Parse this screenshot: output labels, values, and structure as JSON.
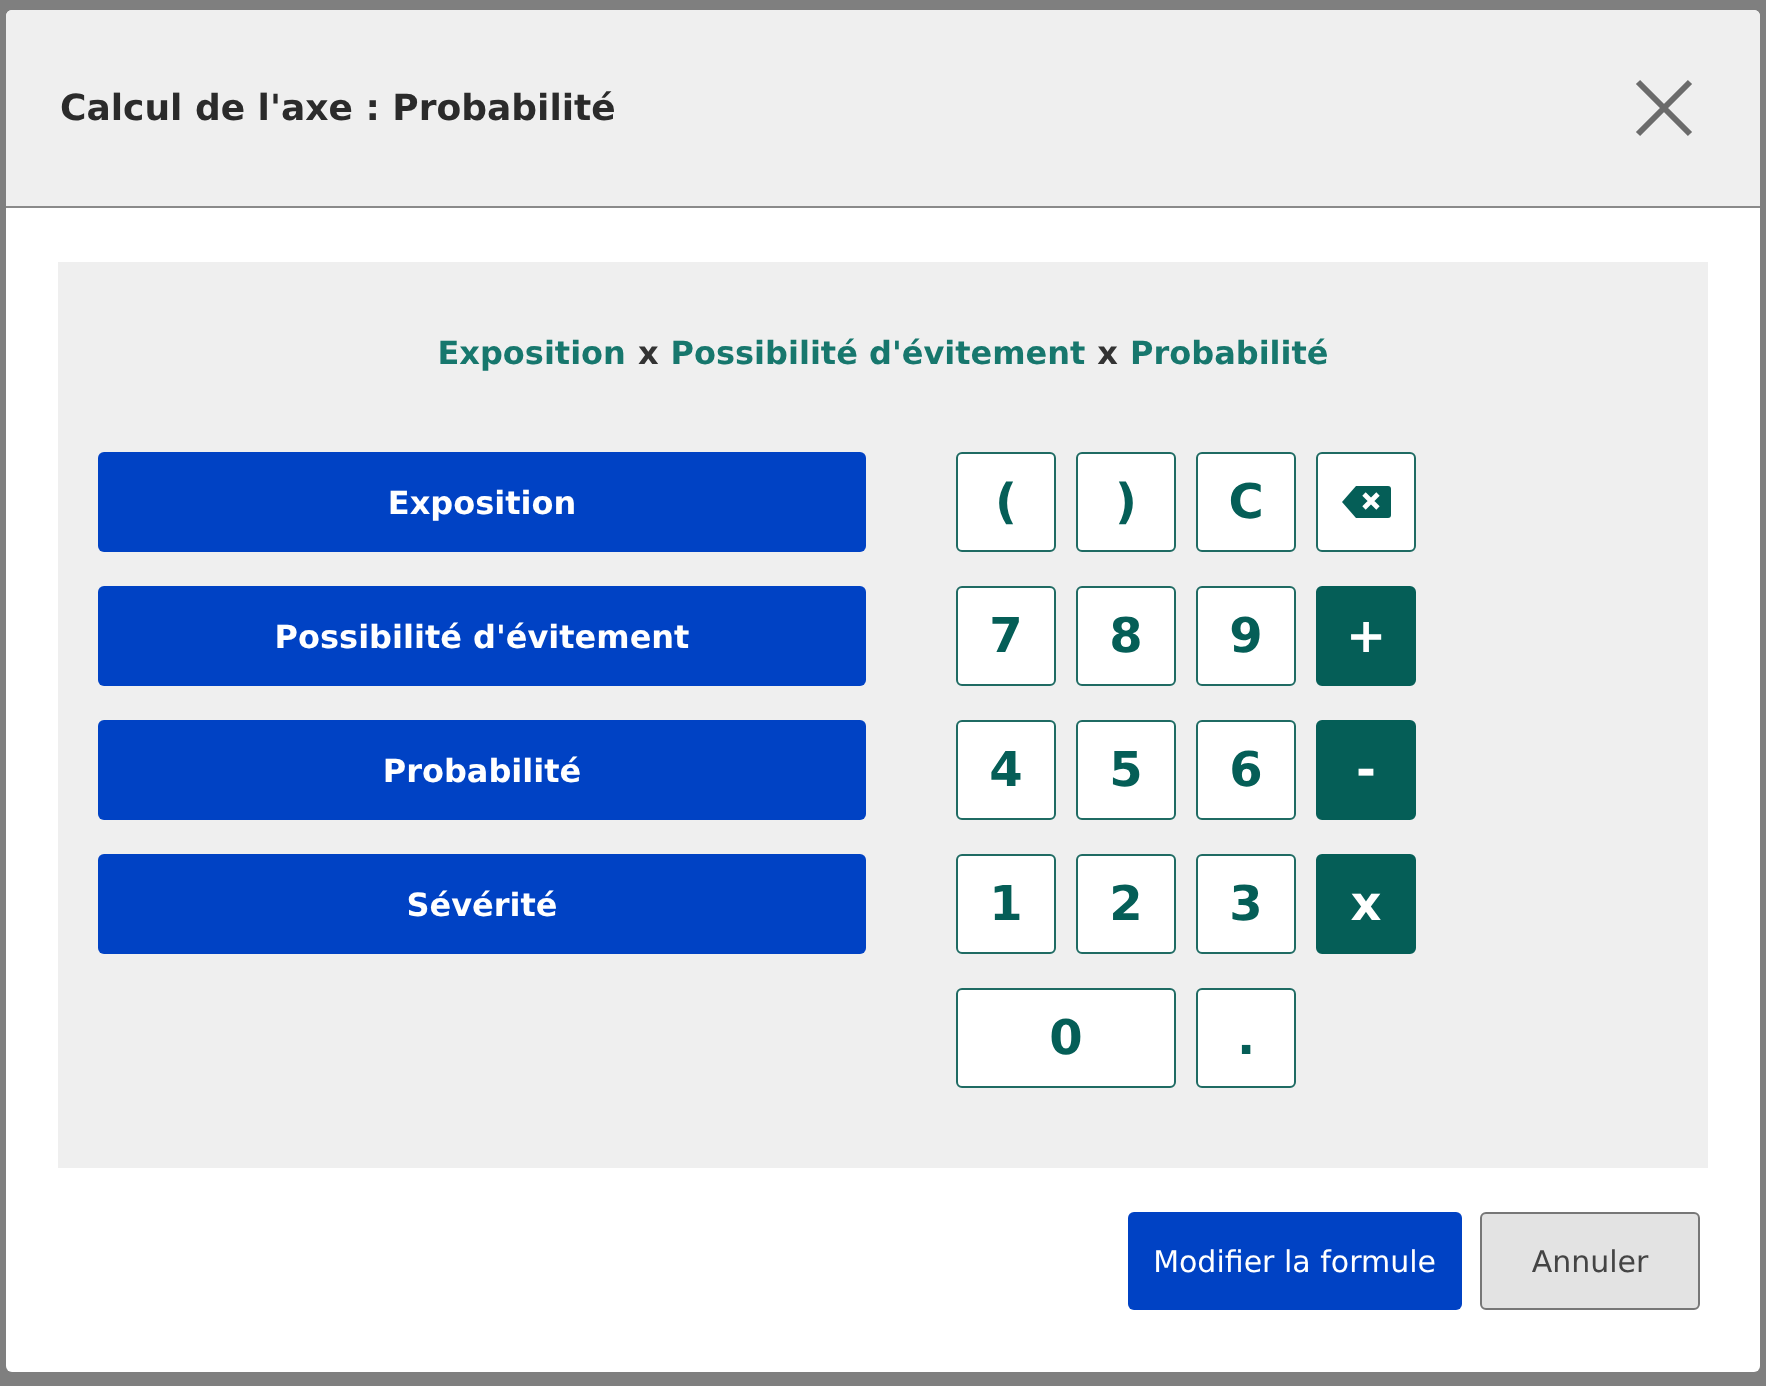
{
  "dialog": {
    "title": "Calcul de l'axe : Probabilité"
  },
  "formula": [
    {
      "kind": "variable",
      "text": "Exposition"
    },
    {
      "kind": "operator",
      "text": "x"
    },
    {
      "kind": "variable",
      "text": "Possibilité d'évitement"
    },
    {
      "kind": "operator",
      "text": "x"
    },
    {
      "kind": "variable",
      "text": "Probabilité"
    }
  ],
  "variables": [
    "Exposition",
    "Possibilité d'évitement",
    "Probabilité",
    "Sévérité"
  ],
  "keypad": [
    {
      "kind": "key",
      "label": "("
    },
    {
      "kind": "key",
      "label": ")"
    },
    {
      "kind": "key",
      "label": "C"
    },
    {
      "kind": "backspace"
    },
    {
      "kind": "key",
      "label": "7"
    },
    {
      "kind": "key",
      "label": "8"
    },
    {
      "kind": "key",
      "label": "9"
    },
    {
      "kind": "operator",
      "label": "+"
    },
    {
      "kind": "key",
      "label": "4"
    },
    {
      "kind": "key",
      "label": "5"
    },
    {
      "kind": "key",
      "label": "6"
    },
    {
      "kind": "operator",
      "label": "-"
    },
    {
      "kind": "key",
      "label": "1"
    },
    {
      "kind": "key",
      "label": "2"
    },
    {
      "kind": "key",
      "label": "3"
    },
    {
      "kind": "operator",
      "label": "x"
    },
    {
      "kind": "wide",
      "label": "0"
    },
    {
      "kind": "key",
      "label": "."
    }
  ],
  "buttons": {
    "primary": "Modifier la formule",
    "secondary": "Annuler"
  }
}
